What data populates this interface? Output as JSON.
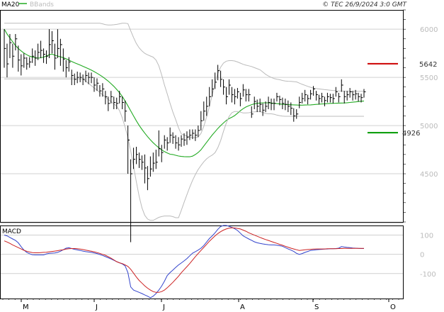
{
  "header": {
    "legend": [
      {
        "label": "MA20",
        "color": "#22aa22"
      },
      {
        "label": "BBands",
        "color": "#bbbbbb"
      }
    ],
    "source": "© TEC 26/9/2024 3:0 GMT"
  },
  "macd_label": "MACD",
  "chart_data": [
    {
      "type": "line",
      "panel": "price",
      "title": "",
      "x_tick_labels": [
        "M",
        "J",
        "J",
        "A",
        "S",
        "O"
      ],
      "y_ticks": [
        4500,
        5000,
        5500,
        6000
      ],
      "ylim": [
        4000,
        6200
      ],
      "grid": true,
      "x": [
        0,
        1,
        2,
        3,
        4,
        5,
        6,
        7,
        8,
        9,
        10,
        11,
        12,
        13,
        14,
        15,
        16,
        17,
        18,
        19,
        20,
        21,
        22,
        23,
        24,
        25,
        26,
        27,
        28,
        29,
        30,
        31,
        32,
        33,
        34,
        35,
        36,
        37,
        38,
        39,
        40,
        41,
        42,
        43,
        44,
        45,
        46,
        47,
        48,
        49,
        50,
        51,
        52,
        53,
        54,
        55,
        56,
        57,
        58,
        59,
        60,
        61,
        62,
        63,
        64,
        65,
        66,
        67,
        68,
        69,
        70,
        71,
        72,
        73,
        74,
        75,
        76,
        77,
        78,
        79,
        80,
        81,
        82,
        83,
        84,
        85,
        86,
        87,
        88,
        89,
        90,
        91,
        92,
        93,
        94,
        95,
        96,
        97,
        98,
        99,
        100,
        101,
        102,
        103,
        104,
        105,
        106,
        107,
        108,
        109,
        110,
        111,
        112,
        113,
        114,
        115,
        116,
        117,
        118,
        119,
        120,
        121,
        122,
        123,
        124,
        125,
        126,
        127,
        128
      ],
      "close": [
        5800,
        5640,
        5860,
        5720,
        5900,
        5680,
        5620,
        5700,
        5640,
        5660,
        5720,
        5700,
        5760,
        5780,
        5740,
        5720,
        5840,
        5880,
        5700,
        5800,
        5840,
        5690,
        5600,
        5660,
        5520,
        5480,
        5500,
        5500,
        5480,
        5520,
        5500,
        5500,
        5420,
        5440,
        5360,
        5380,
        5300,
        5230,
        5300,
        5240,
        5230,
        5300,
        5240,
        5150,
        4850,
        4500,
        4650,
        4700,
        4650,
        4620,
        4560,
        4450,
        4550,
        4610,
        4620,
        4760,
        4720,
        4850,
        4820,
        4900,
        4880,
        4820,
        4800,
        4860,
        4850,
        4880,
        4900,
        4920,
        4900,
        4950,
        5050,
        5150,
        5200,
        5300,
        5380,
        5450,
        5570,
        5480,
        5400,
        5300,
        5420,
        5320,
        5300,
        5350,
        5280,
        5370,
        5320,
        5320,
        5120,
        5250,
        5200,
        5220,
        5160,
        5200,
        5240,
        5230,
        5230,
        5300,
        5270,
        5230,
        5220,
        5200,
        5180,
        5100,
        5120,
        5240,
        5280,
        5320,
        5280,
        5330,
        5380,
        5320,
        5280,
        5300,
        5260,
        5300,
        5290,
        5280,
        5350,
        5300,
        5420,
        5300,
        5320,
        5350,
        5320,
        5330,
        5300,
        5290,
        5350
      ],
      "high": [
        6000,
        5850,
        5950,
        5850,
        5950,
        5830,
        5740,
        5750,
        5710,
        5710,
        5800,
        5780,
        5850,
        5880,
        5800,
        5780,
        6000,
        5980,
        5850,
        6000,
        5900,
        5800,
        5680,
        5710,
        5580,
        5540,
        5560,
        5550,
        5530,
        5570,
        5550,
        5550,
        5500,
        5490,
        5420,
        5440,
        5360,
        5300,
        5360,
        5300,
        5290,
        5360,
        5300,
        5260,
        5000,
        4650,
        4770,
        4780,
        4720,
        4690,
        4700,
        4580,
        4680,
        4720,
        4750,
        4950,
        4800,
        4900,
        4880,
        4980,
        4930,
        4900,
        4880,
        4900,
        4920,
        4940,
        4960,
        4960,
        4960,
        5000,
        5150,
        5250,
        5300,
        5400,
        5480,
        5550,
        5630,
        5570,
        5480,
        5400,
        5480,
        5400,
        5380,
        5390,
        5340,
        5430,
        5380,
        5380,
        5200,
        5300,
        5270,
        5280,
        5230,
        5250,
        5300,
        5280,
        5280,
        5340,
        5310,
        5290,
        5280,
        5260,
        5240,
        5180,
        5170,
        5300,
        5340,
        5370,
        5320,
        5370,
        5410,
        5360,
        5320,
        5340,
        5300,
        5340,
        5330,
        5330,
        5400,
        5340,
        5480,
        5360,
        5360,
        5390,
        5360,
        5370,
        5340,
        5330,
        5380
      ],
      "low": [
        5600,
        5500,
        5700,
        5600,
        5780,
        5560,
        5520,
        5600,
        5580,
        5600,
        5650,
        5620,
        5680,
        5700,
        5650,
        5640,
        5700,
        5750,
        5580,
        5700,
        5620,
        5560,
        5500,
        5560,
        5420,
        5420,
        5440,
        5450,
        5420,
        5450,
        5430,
        5440,
        5350,
        5360,
        5300,
        5300,
        5220,
        5150,
        5230,
        5170,
        5170,
        5230,
        5170,
        5040,
        4500,
        3790,
        4550,
        4600,
        4560,
        4540,
        4400,
        4330,
        4470,
        4520,
        4550,
        4680,
        4620,
        4760,
        4740,
        4820,
        4810,
        4760,
        4740,
        4780,
        4790,
        4800,
        4850,
        4860,
        4840,
        4880,
        4950,
        5050,
        5100,
        5200,
        5300,
        5380,
        5470,
        5400,
        5320,
        5220,
        5320,
        5240,
        5220,
        5280,
        5200,
        5300,
        5250,
        5250,
        5080,
        5170,
        5140,
        5140,
        5100,
        5140,
        5170,
        5160,
        5160,
        5250,
        5210,
        5170,
        5160,
        5140,
        5110,
        5040,
        5070,
        5180,
        5230,
        5250,
        5220,
        5270,
        5310,
        5260,
        5220,
        5240,
        5200,
        5240,
        5240,
        5230,
        5300,
        5240,
        5350,
        5230,
        5260,
        5290,
        5260,
        5270,
        5250,
        5240,
        5290
      ],
      "series": [
        {
          "name": "MA20",
          "color": "#22aa22",
          "values": [
            6001,
            5950,
            5910,
            5870,
            5830,
            5800,
            5775,
            5753,
            5735,
            5720,
            5712,
            5705,
            5700,
            5703,
            5711,
            5722,
            5735,
            5742,
            5730,
            5721,
            5714,
            5705,
            5693,
            5680,
            5665,
            5652,
            5640,
            5628,
            5615,
            5602,
            5589,
            5575,
            5560,
            5543,
            5525,
            5506,
            5484,
            5461,
            5435,
            5407,
            5375,
            5342,
            5302,
            5255,
            5205,
            5152,
            5100,
            5050,
            5002,
            4960,
            4922,
            4885,
            4852,
            4822,
            4795,
            4770,
            4748,
            4730,
            4715,
            4703,
            4700,
            4692,
            4684,
            4680,
            4678,
            4676,
            4676,
            4683,
            4700,
            4720,
            4748,
            4788,
            4826,
            4864,
            4902,
            4936,
            4970,
            5000,
            5027,
            5053,
            5073,
            5087,
            5104,
            5128,
            5154,
            5175,
            5193,
            5206,
            5217,
            5226,
            5231,
            5234,
            5236,
            5236,
            5236,
            5234,
            5231,
            5228,
            5224,
            5221,
            5219,
            5218,
            5216,
            5215,
            5213,
            5212,
            5212,
            5213,
            5214,
            5215,
            5217,
            5220,
            5222,
            5224,
            5226,
            5228,
            5230,
            5231,
            5232,
            5233,
            5234,
            5235,
            5237,
            5240,
            5243,
            5246,
            5249,
            5252,
            5255
          ]
        },
        {
          "name": "BBands upper",
          "color": "#bbbbbb",
          "values": [
            6062,
            6062,
            6062,
            6062,
            6062,
            6062,
            6062,
            6062,
            6062,
            6062,
            6062,
            6062,
            6062,
            6062,
            6062,
            6062,
            6062,
            6062,
            6062,
            6062,
            6062,
            6062,
            6062,
            6062,
            6062,
            6062,
            6062,
            6062,
            6062,
            6062,
            6062,
            6062,
            6062,
            6062,
            6062,
            6056,
            6048,
            6044,
            6044,
            6046,
            6050,
            6056,
            6062,
            6062,
            6058,
            5984,
            5914,
            5852,
            5806,
            5774,
            5750,
            5734,
            5722,
            5710,
            5680,
            5620,
            5526,
            5422,
            5328,
            5230,
            5141,
            5062,
            4977,
            4914,
            4901,
            4891,
            4883,
            4875,
            4875,
            4883,
            4918,
            4992,
            5090,
            5195,
            5318,
            5446,
            5540,
            5606,
            5648,
            5668,
            5674,
            5674,
            5670,
            5660,
            5648,
            5636,
            5627,
            5620,
            5613,
            5601,
            5590,
            5579,
            5556,
            5532,
            5514,
            5500,
            5488,
            5481,
            5476,
            5468,
            5463,
            5460,
            5458,
            5456,
            5453,
            5441,
            5428,
            5418,
            5407,
            5397,
            5389,
            5384,
            5380,
            5377,
            5373,
            5370,
            5367,
            5364,
            5362,
            5360,
            5358,
            5357,
            5356,
            5356,
            5356,
            5356,
            5356,
            5356,
            5356
          ]
        },
        {
          "name": "BBands lower",
          "color": "#bbbbbb",
          "values": [
            5484,
            5484,
            5484,
            5484,
            5484,
            5484,
            5484,
            5484,
            5484,
            5484,
            5484,
            5484,
            5484,
            5484,
            5484,
            5484,
            5484,
            5484,
            5484,
            5484,
            5484,
            5484,
            5484,
            5484,
            5484,
            5484,
            5484,
            5484,
            5484,
            5460,
            5437,
            5414,
            5391,
            5368,
            5344,
            5320,
            5296,
            5272,
            5248,
            5225,
            5201,
            5157,
            5080,
            4984,
            4876,
            4736,
            4578,
            4418,
            4266,
            4146,
            4069,
            4030,
            4016,
            4016,
            4032,
            4048,
            4056,
            4062,
            4062,
            4062,
            4055,
            4044,
            4044,
            4120,
            4204,
            4284,
            4360,
            4431,
            4492,
            4544,
            4586,
            4624,
            4655,
            4677,
            4694,
            4719,
            4770,
            4844,
            4940,
            5025,
            5095,
            5134,
            5146,
            5146,
            5139,
            5132,
            5132,
            5133,
            5138,
            5143,
            5145,
            5145,
            5137,
            5126,
            5122,
            5122,
            5118,
            5109,
            5103,
            5098,
            5096,
            5096,
            5096,
            5096,
            5096,
            5096,
            5096,
            5096,
            5096,
            5096,
            5096,
            5096,
            5096,
            5096,
            5096,
            5096,
            5096,
            5096,
            5096,
            5096,
            5096,
            5096,
            5096,
            5096,
            5096,
            5096,
            5096,
            5096,
            5096
          ]
        }
      ],
      "annotations": [
        {
          "value": 5642,
          "label": "5642",
          "color": "#cc0000"
        },
        {
          "value": 4926,
          "label": "4926",
          "color": "#009900"
        }
      ]
    },
    {
      "type": "line",
      "panel": "macd",
      "title": "MACD",
      "y_ticks": [
        -100,
        0,
        100
      ],
      "ylim": [
        -230,
        150
      ],
      "grid": true,
      "series": [
        {
          "name": "MACD",
          "color": "#3344cc",
          "values": [
            100,
            96,
            88,
            80,
            72,
            60,
            40,
            22,
            10,
            3,
            -2,
            -3,
            -3,
            -3,
            -3,
            2,
            5,
            6,
            7,
            10,
            16,
            24,
            32,
            34,
            30,
            26,
            23,
            20,
            17,
            14,
            12,
            10,
            7,
            4,
            -1,
            -6,
            -12,
            -18,
            -24,
            -31,
            -38,
            -44,
            -50,
            -60,
            -95,
            -170,
            -186,
            -192,
            -198,
            -204,
            -211,
            -218,
            -226,
            -218,
            -204,
            -186,
            -165,
            -140,
            -110,
            -95,
            -82,
            -68,
            -55,
            -45,
            -34,
            -22,
            -8,
            6,
            14,
            22,
            32,
            46,
            64,
            82,
            96,
            112,
            130,
            145,
            150,
            150,
            146,
            140,
            133,
            124,
            110,
            96,
            88,
            80,
            73,
            65,
            60,
            57,
            54,
            52,
            50,
            49,
            49,
            47,
            45,
            42,
            35,
            28,
            22,
            15,
            5,
            0,
            4,
            10,
            15,
            20,
            22,
            24,
            25,
            26,
            27,
            28,
            29,
            29,
            30,
            32,
            40,
            38,
            36,
            35,
            33,
            32,
            31,
            30,
            30
          ]
        },
        {
          "name": "Signal",
          "color": "#cc2222",
          "values": [
            70,
            64,
            57,
            49,
            42,
            35,
            28,
            21,
            16,
            12,
            9,
            8,
            8,
            9,
            10,
            11,
            13,
            15,
            17,
            19,
            22,
            24,
            27,
            29,
            30,
            30,
            29,
            27,
            25,
            22,
            19,
            16,
            13,
            9,
            5,
            0,
            -5,
            -12,
            -20,
            -29,
            -38,
            -44,
            -48,
            -55,
            -63,
            -78,
            -98,
            -118,
            -136,
            -150,
            -164,
            -176,
            -186,
            -194,
            -198,
            -198,
            -194,
            -186,
            -174,
            -160,
            -146,
            -130,
            -114,
            -96,
            -80,
            -64,
            -48,
            -30,
            -12,
            4,
            20,
            36,
            52,
            68,
            82,
            96,
            108,
            118,
            126,
            132,
            136,
            138,
            137,
            135,
            132,
            126,
            120,
            112,
            106,
            100,
            94,
            88,
            82,
            77,
            72,
            67,
            62,
            57,
            52,
            47,
            42,
            37,
            32,
            28,
            24,
            20,
            22,
            24,
            25,
            26,
            27,
            28,
            28,
            28,
            28,
            29,
            29,
            29,
            29,
            30,
            30,
            31,
            31,
            31,
            31,
            31,
            31,
            31,
            31
          ]
        }
      ]
    }
  ]
}
